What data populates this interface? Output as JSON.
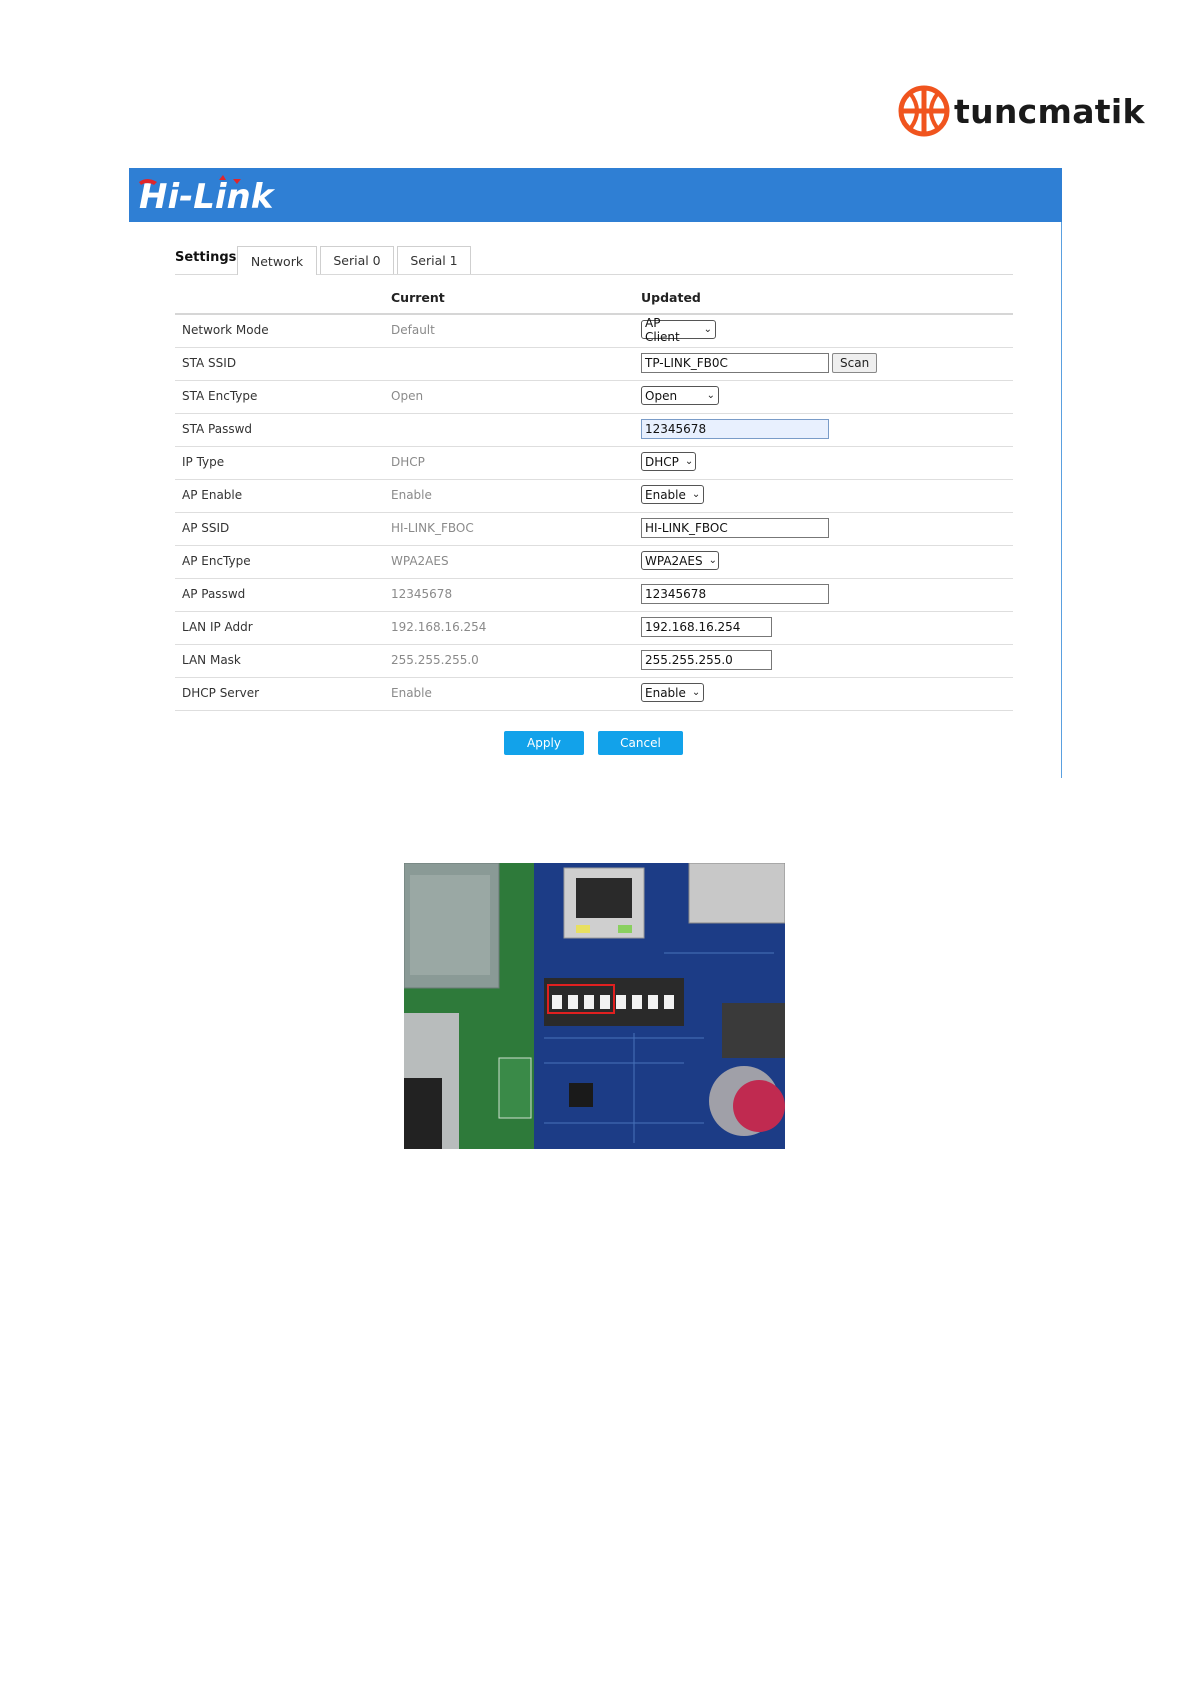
{
  "brand": {
    "name": "tuncmatik"
  },
  "app": {
    "logo_text": "Hi-Link"
  },
  "tabs": {
    "settings_label": "Settings",
    "items": [
      {
        "label": "Network"
      },
      {
        "label": "Serial 0"
      },
      {
        "label": "Serial 1"
      }
    ]
  },
  "table": {
    "header_current": "Current",
    "header_updated": "Updated",
    "rows": [
      {
        "label": "Network Mode",
        "current": "Default",
        "updated": "AP Client",
        "control": "select"
      },
      {
        "label": "STA SSID",
        "current": "",
        "updated": "TP-LINK_FB0C",
        "control": "input",
        "button": "Scan"
      },
      {
        "label": "STA EncType",
        "current": "Open",
        "updated": "Open",
        "control": "select"
      },
      {
        "label": "STA Passwd",
        "current": "",
        "updated": "12345678",
        "control": "input"
      },
      {
        "label": "IP Type",
        "current": "DHCP",
        "updated": "DHCP",
        "control": "select"
      },
      {
        "label": "AP Enable",
        "current": "Enable",
        "updated": "Enable",
        "control": "select"
      },
      {
        "label": "AP SSID",
        "current": "HI-LINK_FBOC",
        "updated": "HI-LINK_FBOC",
        "control": "input"
      },
      {
        "label": "AP EncType",
        "current": "WPA2AES",
        "updated": "WPA2AES",
        "control": "select"
      },
      {
        "label": "AP Passwd",
        "current": "12345678",
        "updated": "12345678",
        "control": "input"
      },
      {
        "label": "LAN IP Addr",
        "current": "192.168.16.254",
        "updated": "192.168.16.254",
        "control": "input"
      },
      {
        "label": "LAN Mask",
        "current": "255.255.255.0",
        "updated": "255.255.255.0",
        "control": "input"
      },
      {
        "label": "DHCP Server",
        "current": "Enable",
        "updated": "Enable",
        "control": "select"
      }
    ]
  },
  "actions": {
    "apply_label": "Apply",
    "cancel_label": "Cancel"
  },
  "colors": {
    "header_blue": "#2f7fd4",
    "button_blue": "#12a2ea",
    "brand_orange": "#f0541e",
    "logo_red": "#e0262b"
  }
}
